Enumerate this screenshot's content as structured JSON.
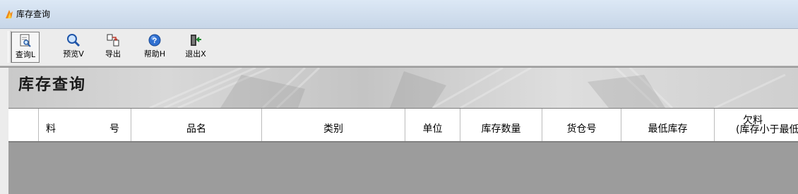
{
  "window": {
    "title": "库存查询",
    "icon": "app-flame-icon"
  },
  "toolbar": {
    "buttons": [
      {
        "label": "查询L",
        "icon": "query-document-icon"
      },
      {
        "label": "预览V",
        "icon": "preview-magnifier-icon"
      },
      {
        "label": "导出",
        "icon": "export-icon"
      },
      {
        "label": "帮助H",
        "icon": "help-icon"
      },
      {
        "label": "退出X",
        "icon": "exit-door-icon"
      }
    ]
  },
  "banner": {
    "title": "库存查询"
  },
  "table": {
    "columns": [
      {
        "label": ""
      },
      {
        "label": "料",
        "label_b": "号"
      },
      {
        "label": "品名"
      },
      {
        "label": "类别"
      },
      {
        "label": "单位"
      },
      {
        "label": "库存数量"
      },
      {
        "label": "货仓号"
      },
      {
        "label": "最低库存"
      },
      {
        "label": "欠料",
        "label2": "(库存小于最低"
      }
    ],
    "rows": []
  },
  "colors": {
    "grid_background": "#9c9c9c",
    "header_background": "#ffffff",
    "toolbar": "#ececec"
  }
}
